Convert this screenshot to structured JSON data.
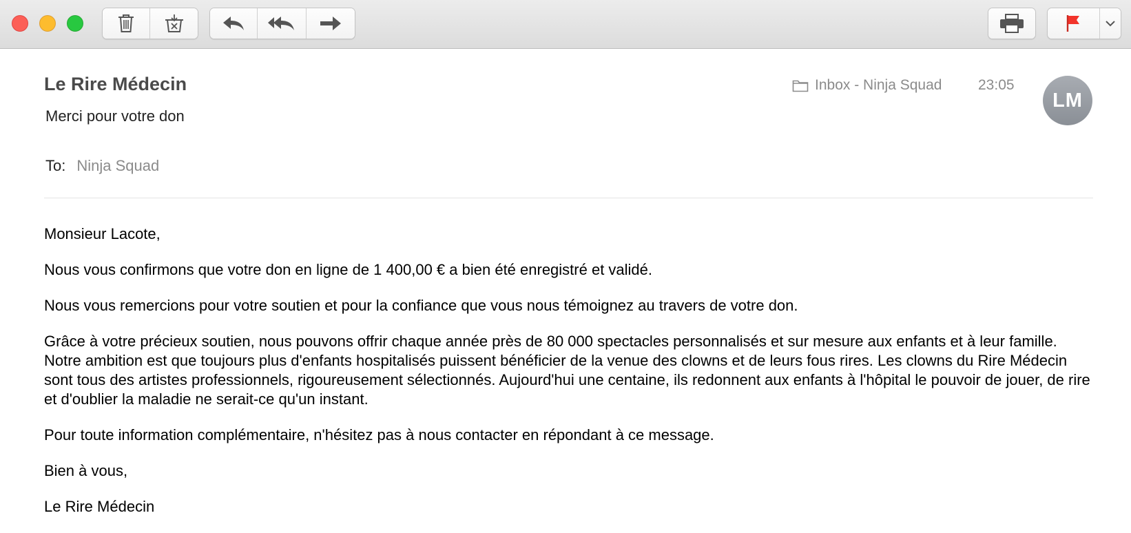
{
  "window": {
    "traffic_lights": [
      "close",
      "minimize",
      "zoom"
    ]
  },
  "toolbar": {
    "left_groups": [
      [
        "trash-icon",
        "junk-icon"
      ],
      [
        "reply-icon",
        "reply-all-icon",
        "forward-icon"
      ]
    ],
    "right_groups": [
      [
        "printer-icon"
      ],
      [
        "flag-icon",
        "chevron-down-icon"
      ]
    ],
    "flag_color": "#f2342b"
  },
  "header": {
    "sender": "Le Rire Médecin",
    "subject": "Merci pour votre don",
    "mailbox": "Inbox - Ninja Squad",
    "time": "23:05",
    "avatar_initials": "LM",
    "to_label": "To:",
    "to_value": "Ninja Squad"
  },
  "body": {
    "paragraphs": [
      "Monsieur Lacote,",
      "Nous vous confirmons que votre don en ligne de 1 400,00 € a bien été enregistré et validé.",
      "Nous vous remercions pour votre soutien et pour la confiance que vous nous témoignez au travers de votre don.",
      "Grâce à votre précieux soutien, nous pouvons offrir chaque année près de 80 000 spectacles personnalisés et sur mesure aux enfants et à leur famille. Notre ambition est que toujours plus d'enfants hospitalisés puissent bénéficier de la venue des clowns et de leurs fous rires. Les clowns du Rire Médecin sont tous des artistes professionnels, rigoureusement sélectionnés. Aujourd'hui une centaine, ils redonnent aux enfants à l'hôpital le pouvoir de jouer, de rire et d'oublier la maladie ne serait-ce qu'un instant.",
      "Pour toute information complémentaire, n'hésitez pas à nous contacter en répondant à ce message.",
      "Bien à vous,",
      "Le Rire Médecin"
    ]
  }
}
